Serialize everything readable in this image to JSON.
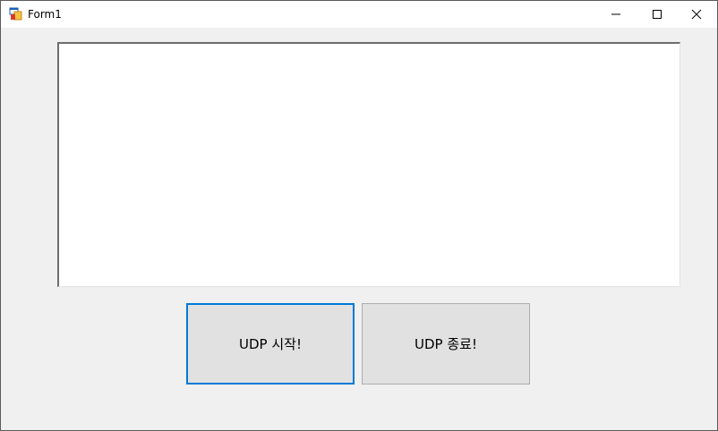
{
  "window": {
    "title": "Form1",
    "icon": "windows-forms-app-icon",
    "controls": {
      "minimize": "minimize-icon",
      "maximize": "maximize-icon",
      "close": "close-icon"
    }
  },
  "main": {
    "textbox_value": "",
    "start_button_label": "UDP 시작!",
    "stop_button_label": "UDP 종료!"
  },
  "colors": {
    "focus_border": "#0078d7",
    "button_face": "#e1e1e1",
    "form_background": "#f0f0f0"
  }
}
